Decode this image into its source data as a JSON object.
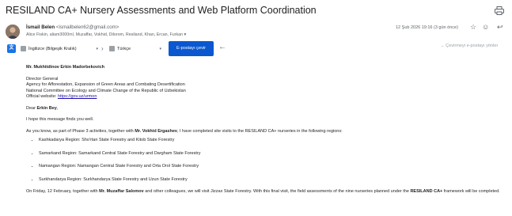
{
  "email": {
    "subject": "RESILAND CA+ Nursery Assessments and Web Platform Coordination",
    "sender_name": "İsmail Belen",
    "sender_email": "<ismailbelen62@gmail.com>",
    "date": "12 Şub 2026 19:16 (3 gün önce)",
    "recipients": "Alice Fiskin, aliam3000ml, Muzaffar, Vokhid, Dilorom, Resiland, Khan, Ercan, Furkan"
  },
  "translate_bar": {
    "source_language": "İngilizce (Bilgeşik Kralık)",
    "target_language": "Türkçe",
    "translate_button": "E-postayı çevir",
    "no_translate": "Çevirmeyi e-postayı yönler"
  },
  "body": {
    "greeting_name": "Mr. Mukhitdinov Erkin Madorbekovich",
    "addressee_lines": [
      "Director General",
      "Agency for Afforestation, Expansion of Green Areas and Combating Desertification",
      "National Committee on Ecology and Climate Change of the Republic of Uzbekistan",
      "Official website: "
    ],
    "website": "https://gov.uz/urmon",
    "salutation_prefix": "Dear ",
    "salutation_name": "Erkin Bey",
    "salutation_suffix": ",",
    "hope": "I hope this message finds you well.",
    "para1_prefix": "As you know, as part of Phase 3 activities, together with ",
    "para1_name": "Mr. Vokhid Ergashev",
    "para1_suffix": ", I have completed site visits to the RESILAND CA+ nurseries in the following regions:",
    "regions": [
      "Kashkadarya Region: Sho'rtan State Forestry and Kitob State Forestry",
      "Samarkand Region: Samarkand Central State Forestry and Dargham State Forestry",
      "Namangan Region: Namangan Central State Forestry and Orta Orol State Forestry",
      "Surkhandarya Region: Surkhandarya State Forestry and Uzun State Forestry"
    ],
    "para2_prefix": "On Friday, 12 February, together with ",
    "para2_name": "Mr. Muzaffar Salomov",
    "para2_mid": " and other colleagues, we will visit Jizzax State Forestry. With this final visit, the field assessments of the nine nurseries planned under the ",
    "para2_program": "RESILAND CA+",
    "para2_suffix": " framework will be completed."
  }
}
